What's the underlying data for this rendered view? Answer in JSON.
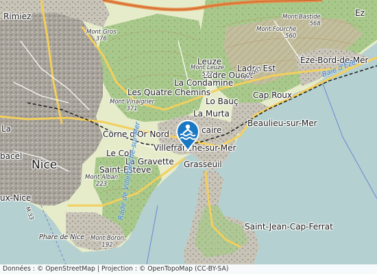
{
  "map": {
    "towns": [
      {
        "id": "nice",
        "name": "Nice"
      },
      {
        "id": "rimiez",
        "name": "Rimiez"
      },
      {
        "id": "leuze",
        "name": "Leuze"
      },
      {
        "id": "ladre-est",
        "name": "Ladre Est"
      },
      {
        "id": "ladre-ouest",
        "name": "Ladre Ouest"
      },
      {
        "id": "la-condamine",
        "name": "La Condamine"
      },
      {
        "id": "les-quatre-chemins",
        "name": "Les Quatre Chemins"
      },
      {
        "id": "lo-bauc",
        "name": "Lo Bauç"
      },
      {
        "id": "cap-roux",
        "name": "Cap Roux"
      },
      {
        "id": "eze-bord-de-mer",
        "name": "Èze-Bord-de-Mer"
      },
      {
        "id": "la-murta",
        "name": "La Murta"
      },
      {
        "id": "beaulieu-sur-mer",
        "name": "Beaulieu-sur-Mer"
      },
      {
        "id": "corne-d-or-nord",
        "name": "Corne d'Or Nord"
      },
      {
        "id": "villefranche-sur-mer",
        "name": "Villefranche-sur-Mer"
      },
      {
        "id": "le-col",
        "name": "Le Col"
      },
      {
        "id": "la-gravette",
        "name": "La Gravette"
      },
      {
        "id": "saint-esteve",
        "name": "Saint-Estève"
      },
      {
        "id": "grasseuil",
        "name": "Grasseuil"
      },
      {
        "id": "saint-jean-cap-ferrat",
        "name": "Saint-Jean-Cap-Ferrat"
      },
      {
        "id": "caire",
        "name": "caire"
      },
      {
        "id": "bacel",
        "name": "bacel"
      },
      {
        "id": "ux-nice",
        "name": "ux-Nice"
      },
      {
        "id": "la-fragment",
        "name": "La"
      },
      {
        "id": "ez-fragment",
        "name": "Ez"
      }
    ],
    "peaks": [
      {
        "id": "mont-gros",
        "name": "Mont Gros",
        "elevation": "376"
      },
      {
        "id": "mont-bastide",
        "name": "Mont Bastide",
        "elevation": "568"
      },
      {
        "id": "mont-fourche",
        "name": "Mont Fourche",
        "elevation": "560"
      },
      {
        "id": "mont-leuze",
        "name": "Mont Leuze",
        "elevation": "577"
      },
      {
        "id": "mont-vinaigrier",
        "name": "Mont Vinaigrier",
        "elevation": "371"
      },
      {
        "id": "mont-alban",
        "name": "Mont Alban",
        "elevation": "223"
      },
      {
        "id": "mont-boron",
        "name": "Mont Boron",
        "elevation": "192"
      }
    ],
    "water_labels": [
      {
        "id": "baie-d-eze",
        "name": "Baie d'Èze"
      },
      {
        "id": "rade-villefranche",
        "name": "Rade de Villefranche-sur-Mer"
      },
      {
        "id": "phare-de-nice",
        "name": "Phare de Nice"
      }
    ],
    "road_labels": [
      {
        "id": "m6007",
        "name": "M 6007"
      },
      {
        "id": "m33",
        "name": "M 33"
      }
    ],
    "marker": {
      "icon": "swimming-icon",
      "color": "#1a78c2"
    },
    "colors": {
      "sea": "#b5d0d0",
      "land": "#e9efd0",
      "forest": "#aacb8c",
      "urban": "#b0aba4",
      "motorway": "#e8904a",
      "primary": "#f7d36a"
    }
  },
  "attribution": {
    "text": "Données : © OpenStreetMap | Projection : © OpenTopoMap (CC-BY-SA)"
  }
}
